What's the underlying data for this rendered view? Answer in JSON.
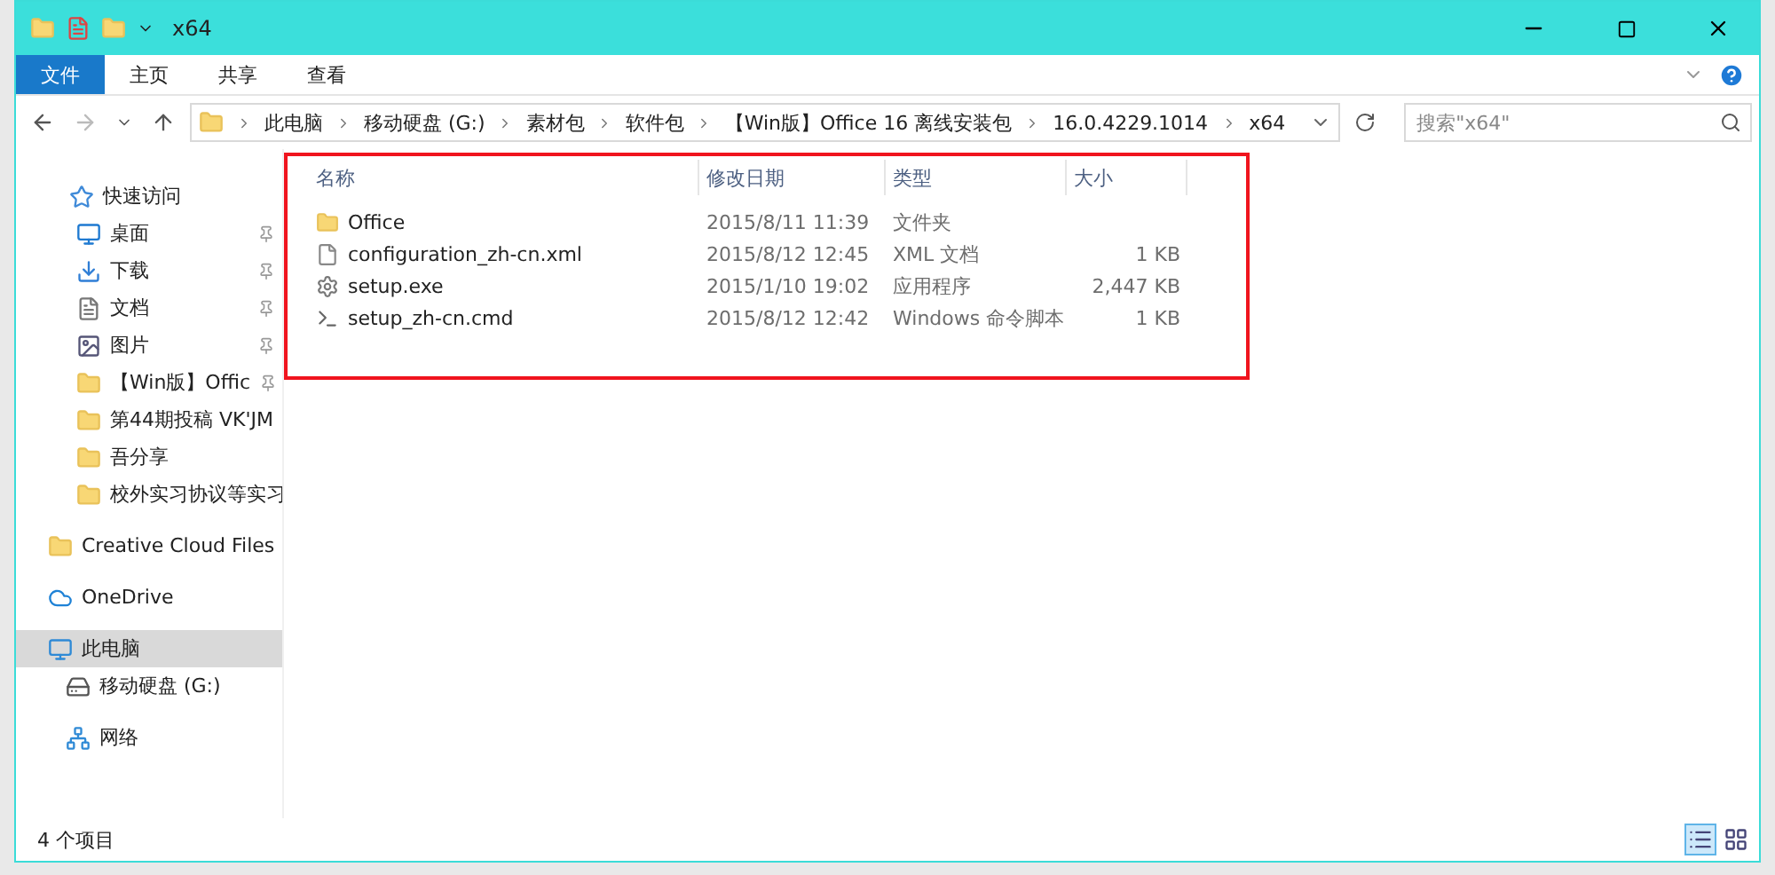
{
  "window": {
    "title": "x64"
  },
  "ribbon_tabs": [
    {
      "label": "文件",
      "selected": true
    },
    {
      "label": "主页",
      "selected": false
    },
    {
      "label": "共享",
      "selected": false
    },
    {
      "label": "查看",
      "selected": false
    }
  ],
  "address_bar": {
    "crumbs": [
      "此电脑",
      "移动硬盘 (G:)",
      "素材包",
      "软件包",
      "【Win版】Office 16 离线安装包",
      "16.0.4229.1014",
      "x64"
    ]
  },
  "search": {
    "placeholder": "搜索\"x64\""
  },
  "sidebar": {
    "items": [
      {
        "label": "快速访问",
        "kind": "star",
        "pinned": false,
        "selected": false
      },
      {
        "label": "桌面",
        "kind": "desktop",
        "pinned": true,
        "selected": false
      },
      {
        "label": "下载",
        "kind": "download",
        "pinned": true,
        "selected": false
      },
      {
        "label": "文档",
        "kind": "document",
        "pinned": true,
        "selected": false
      },
      {
        "label": "图片",
        "kind": "pictures",
        "pinned": true,
        "selected": false
      },
      {
        "label": "【Win版】Offic",
        "kind": "folder",
        "pinned": true,
        "selected": false
      },
      {
        "label": "第44期投稿 VK'JM",
        "kind": "folder",
        "pinned": false,
        "selected": false
      },
      {
        "label": "吾分享",
        "kind": "folder",
        "pinned": false,
        "selected": false
      },
      {
        "label": "校外实习协议等实习",
        "kind": "folder",
        "pinned": false,
        "selected": false
      },
      {
        "label": "Creative Cloud Files",
        "kind": "cloudfolder",
        "pinned": false,
        "selected": false
      },
      {
        "label": "OneDrive",
        "kind": "onedrive",
        "pinned": false,
        "selected": false
      },
      {
        "label": "此电脑",
        "kind": "pc",
        "pinned": false,
        "selected": true
      },
      {
        "label": "移动硬盘 (G:)",
        "kind": "drive",
        "pinned": false,
        "selected": false
      },
      {
        "label": "网络",
        "kind": "network",
        "pinned": false,
        "selected": false
      }
    ]
  },
  "table": {
    "columns": [
      "名称",
      "修改日期",
      "类型",
      "大小"
    ],
    "rows": [
      {
        "name": "Office",
        "kind": "folder",
        "date": "2015/8/11 11:39",
        "type": "文件夹",
        "size": ""
      },
      {
        "name": "configuration_zh-cn.xml",
        "kind": "file",
        "date": "2015/8/12 12:45",
        "type": "XML 文档",
        "size": "1 KB"
      },
      {
        "name": "setup.exe",
        "kind": "exe",
        "date": "2015/1/10 19:02",
        "type": "应用程序",
        "size": "2,447 KB"
      },
      {
        "name": "setup_zh-cn.cmd",
        "kind": "cmd",
        "date": "2015/8/12 12:42",
        "type": "Windows 命令脚本",
        "size": "1 KB"
      }
    ]
  },
  "status_bar": {
    "count": "4 个项目"
  }
}
